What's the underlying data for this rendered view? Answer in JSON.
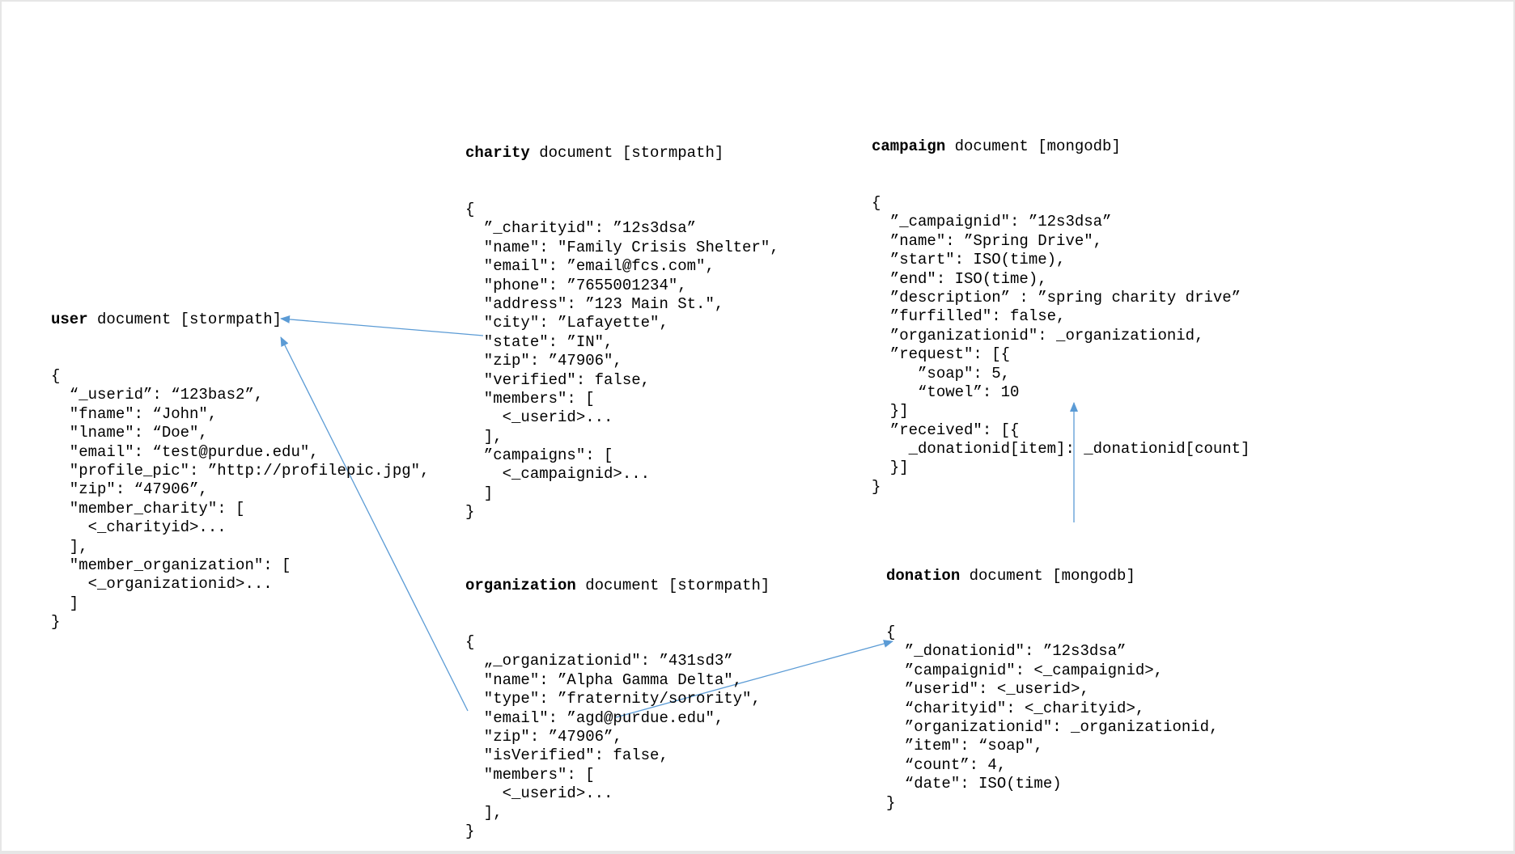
{
  "documents": {
    "user": {
      "name": "user",
      "suffix": " document [stormpath]",
      "lines": [
        "{",
        "  “_userid”: “123bas2”,",
        "  \"fname\": “John\",",
        "  \"lname\": “Doe\",",
        "  \"email\": “test@purdue.edu\",",
        "  \"profile_pic\": ”http://profilepic.jpg\",",
        "  \"zip\": “47906”,",
        "  \"member_charity\": [",
        "    <_charityid>...",
        "  ],",
        "  \"member_organization\": [",
        "    <_organizationid>...",
        "  ]",
        "}"
      ]
    },
    "charity": {
      "name": "charity",
      "suffix": " document [stormpath]",
      "lines": [
        "{",
        "  ”_charityid\": ”12s3dsa”",
        "  \"name\": \"Family Crisis Shelter\",",
        "  \"email\": ”email@fcs.com\",",
        "  \"phone\": ”7655001234\",",
        "  \"address\": ”123 Main St.\",",
        "  \"city\": ”Lafayette\",",
        "  \"state\": ”IN\",",
        "  \"zip\": ”47906\",",
        "  \"verified\": false,",
        "  \"members\": [",
        "    <_userid>...",
        "  ],",
        "  ”campaigns\": [",
        "    <_campaignid>...",
        "  ]",
        "}"
      ]
    },
    "campaign": {
      "name": "campaign",
      "suffix": " document [mongodb]",
      "lines": [
        "{",
        "  ”_campaignid\": ”12s3dsa”",
        "  ”name\": ”Spring Drive\",",
        "  ”start\": ISO(time),",
        "  ”end\": ISO(time),",
        "  ”description” : ”spring charity drive”",
        "  ”furfilled\": false,",
        "  ”organizationid\": _organizationid,",
        "  ”request\": [{",
        "     ”soap\": 5,",
        "     “towel”: 10",
        "  }]",
        "  ”received\": [{",
        "    _donationid[item]: _donationid[count]",
        "  }]",
        "}"
      ]
    },
    "organization": {
      "name": "organization",
      "suffix": " document [stormpath]",
      "lines": [
        "{",
        "  „_organizationid\": ”431sd3”",
        "  \"name\": ”Alpha Gamma Delta\",",
        "  \"type\": ”fraternity/sorority\",",
        "  \"email\": ”agd@purdue.edu\",",
        "  \"zip\": ”47906”,",
        "  \"isVerified\": false,",
        "  \"members\": [",
        "    <_userid>...",
        "  ],",
        "}"
      ]
    },
    "donation": {
      "name": "donation",
      "suffix": " document [mongodb]",
      "lines": [
        "{",
        "  ”_donationid\": ”12s3dsa”",
        "  ”campaignid\": <_campaignid>,",
        "  ”userid\": <_userid>,",
        "  “charityid\": <_charityid>,",
        "  ”organizationid\": _organizationid,",
        "  ”item\": “soap\",",
        "  “count”: 4,",
        "  “date\": ISO(time)",
        "}"
      ]
    }
  },
  "colors": {
    "arrow": "#5b9bd5",
    "text": "#000000"
  }
}
